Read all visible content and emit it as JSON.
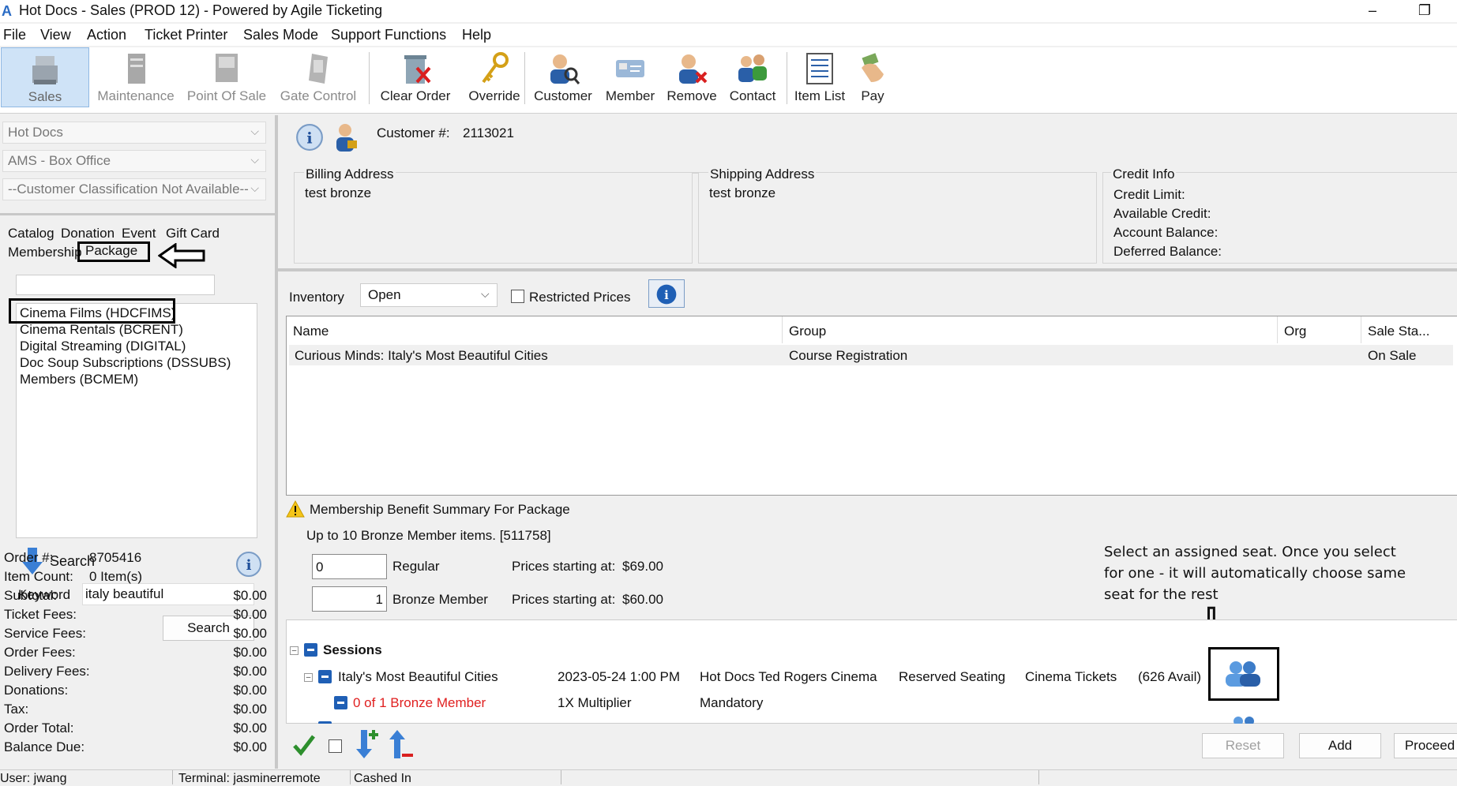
{
  "window": {
    "title": "Hot Docs - Sales (PROD 12) - Powered by Agile Ticketing",
    "minimize": "–",
    "restore": "❐"
  },
  "menu": [
    "File",
    "View",
    "Action",
    "Ticket Printer",
    "Sales Mode",
    "Support Functions",
    "Help"
  ],
  "toolbar": {
    "sales": "Sales",
    "maintenance": "Maintenance",
    "point_of_sale": "Point Of Sale",
    "gate_control": "Gate Control",
    "clear_order": "Clear Order",
    "override": "Override",
    "customer": "Customer",
    "member": "Member",
    "remove": "Remove",
    "contact": "Contact",
    "item_list": "Item List",
    "pay": "Pay"
  },
  "left": {
    "org_select": "Hot Docs",
    "location_select": "AMS - Box Office",
    "classification_select": "--Customer Classification Not Available--",
    "tabs_row1": [
      "Catalog",
      "Donation",
      "Event",
      "Gift Card"
    ],
    "tabs_row2": [
      "Membership",
      "Package"
    ],
    "package_list": [
      "Cinema Films  (HDCFIMS)",
      "Cinema Rentals  (BCRENT)",
      "Digital Streaming  (DIGITAL)",
      "Doc Soup Subscriptions  (DSSUBS)",
      "Members  (BCMEM)"
    ],
    "search_header": "Search",
    "keyword_label": "Keyword",
    "keyword_value": "italy beautiful",
    "search_button": "Search"
  },
  "order": {
    "order_no_label": "Order #:",
    "order_no": "8705416",
    "item_count_label": "Item Count:",
    "item_count": "0 Item(s)",
    "rows": [
      {
        "label": "Subtotal:",
        "value": "$0.00"
      },
      {
        "label": "Ticket Fees:",
        "value": "$0.00"
      },
      {
        "label": "Service Fees:",
        "value": "$0.00"
      },
      {
        "label": "Order Fees:",
        "value": "$0.00"
      },
      {
        "label": "Delivery Fees:",
        "value": "$0.00"
      },
      {
        "label": "Donations:",
        "value": "$0.00"
      },
      {
        "label": "Tax:",
        "value": "$0.00"
      },
      {
        "label": "Order Total:",
        "value": "$0.00"
      },
      {
        "label": "Balance Due:",
        "value": "$0.00"
      }
    ]
  },
  "customer": {
    "number_label": "Customer #:",
    "number": "2113021",
    "billing_title": "Billing Address",
    "billing_value": "test bronze",
    "shipping_title": "Shipping Address",
    "shipping_value": "test bronze",
    "credit_title": "Credit Info",
    "credit_lines": [
      "Credit Limit:",
      "Available Credit:",
      "Account Balance:",
      "Deferred Balance:"
    ]
  },
  "inventory": {
    "label": "Inventory",
    "filter_value": "Open",
    "restricted_label": "Restricted Prices",
    "columns": [
      "Name",
      "Group",
      "Org",
      "Sale Sta..."
    ],
    "rows": [
      {
        "name": "Curious Minds: Italy's Most Beautiful Cities",
        "group": "Course Registration",
        "org": "",
        "status": "On Sale"
      }
    ]
  },
  "benefit": {
    "title": "Membership Benefit Summary For Package",
    "detail": "Up to 10 Bronze Member items. [511758]",
    "prices": [
      {
        "qty": "0",
        "label": "Regular",
        "price_label": "Prices starting at:",
        "price": "$69.00"
      },
      {
        "qty": "1",
        "label": "Bronze Member",
        "price_label": "Prices starting at:",
        "price": "$60.00"
      }
    ]
  },
  "annotation": {
    "text": "Select an assigned seat. Once you select for one - it will automatically choose same seat for the rest",
    "arrow": "⇩"
  },
  "sessions": {
    "title": "Sessions",
    "session_name": "Italy's Most Beautiful Cities",
    "session_date": "2023-05-24 1:00 PM",
    "venue": "Hot Docs Ted Rogers Cinema",
    "seating": "Reserved Seating",
    "ticket_type": "Cinema Tickets",
    "avail": "(626 Avail)",
    "member_line": "0 of 1 Bronze Member",
    "multiplier": "1X Multiplier",
    "mandatory": "Mandatory"
  },
  "actions": {
    "reset": "Reset",
    "add": "Add",
    "proceed": "Proceed"
  },
  "status": {
    "user": "User: jwang",
    "terminal": "Terminal: jasminerremote",
    "cashed": "Cashed In"
  },
  "colors": {
    "accent_blue": "#1f5fb5",
    "member_red": "#e02020",
    "active_tool": "#cfe3f7"
  }
}
